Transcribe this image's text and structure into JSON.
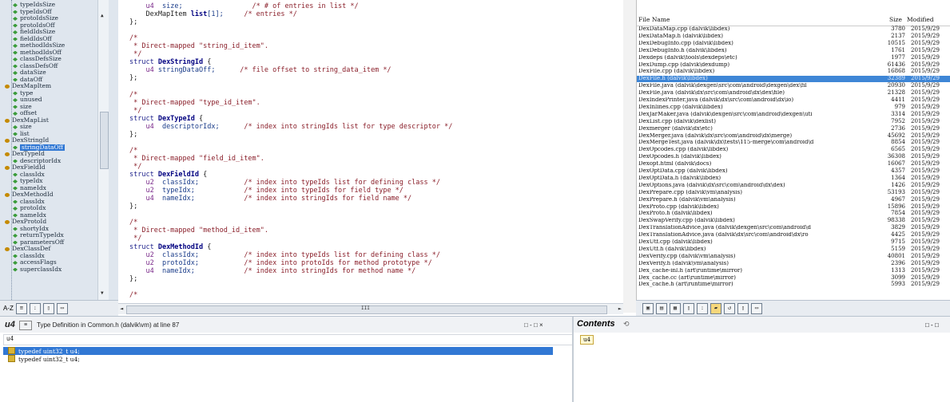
{
  "tree": {
    "rows": [
      {
        "label": "typeIdsSize",
        "kind": "field",
        "indent": 2
      },
      {
        "label": "typeIdsOff",
        "kind": "field",
        "indent": 2
      },
      {
        "label": "protoIdsSize",
        "kind": "field",
        "indent": 2
      },
      {
        "label": "protoIdsOff",
        "kind": "field",
        "indent": 2
      },
      {
        "label": "fieldIdsSize",
        "kind": "field",
        "indent": 2
      },
      {
        "label": "fieldIdsOff",
        "kind": "field",
        "indent": 2
      },
      {
        "label": "methodIdsSize",
        "kind": "field",
        "indent": 2
      },
      {
        "label": "methodIdsOff",
        "kind": "field",
        "indent": 2
      },
      {
        "label": "classDefsSize",
        "kind": "field",
        "indent": 2
      },
      {
        "label": "classDefsOff",
        "kind": "field",
        "indent": 2
      },
      {
        "label": "dataSize",
        "kind": "field",
        "indent": 2
      },
      {
        "label": "dataOff",
        "kind": "field",
        "indent": 2
      },
      {
        "label": "DexMapItem",
        "kind": "struct",
        "indent": 1
      },
      {
        "label": "type",
        "kind": "field",
        "indent": 2
      },
      {
        "label": "unused",
        "kind": "field",
        "indent": 2
      },
      {
        "label": "size",
        "kind": "field",
        "indent": 2
      },
      {
        "label": "offset",
        "kind": "field",
        "indent": 2
      },
      {
        "label": "DexMapList",
        "kind": "struct",
        "indent": 1
      },
      {
        "label": "size",
        "kind": "field",
        "indent": 2
      },
      {
        "label": "list",
        "kind": "field",
        "indent": 2
      },
      {
        "label": "DexStringId",
        "kind": "struct",
        "indent": 1
      },
      {
        "label": "stringDataOff",
        "kind": "field",
        "indent": 2,
        "selected": true
      },
      {
        "label": "DexTypeId",
        "kind": "struct",
        "indent": 1
      },
      {
        "label": "descriptorIdx",
        "kind": "field",
        "indent": 2
      },
      {
        "label": "DexFieldId",
        "kind": "struct",
        "indent": 1
      },
      {
        "label": "classIdx",
        "kind": "field",
        "indent": 2
      },
      {
        "label": "typeIdx",
        "kind": "field",
        "indent": 2
      },
      {
        "label": "nameIdx",
        "kind": "field",
        "indent": 2
      },
      {
        "label": "DexMethodId",
        "kind": "struct",
        "indent": 1
      },
      {
        "label": "classIdx",
        "kind": "field",
        "indent": 2
      },
      {
        "label": "protoIdx",
        "kind": "field",
        "indent": 2
      },
      {
        "label": "nameIdx",
        "kind": "field",
        "indent": 2
      },
      {
        "label": "DexProtoId",
        "kind": "struct",
        "indent": 1
      },
      {
        "label": "shortyIdx",
        "kind": "field",
        "indent": 2
      },
      {
        "label": "returnTypeIdx",
        "kind": "field",
        "indent": 2
      },
      {
        "label": "parametersOff",
        "kind": "field",
        "indent": 2
      },
      {
        "label": "DexClassDef",
        "kind": "struct",
        "indent": 1
      },
      {
        "label": "classIdx",
        "kind": "field",
        "indent": 2
      },
      {
        "label": "accessFlags",
        "kind": "field",
        "indent": 2
      },
      {
        "label": "superclassIdx",
        "kind": "field",
        "indent": 2
      }
    ],
    "toolbar_label": "A-Z"
  },
  "editor": {
    "lines": [
      [
        [
          "    ",
          ""
        ],
        [
          "u4",
          "tp"
        ],
        [
          "  size;",
          "fld"
        ],
        [
          "                 /* # of entries in list */",
          "cm"
        ]
      ],
      [
        [
          "    DexMapItem ",
          ""
        ],
        [
          "list",
          "idn"
        ],
        [
          "[1];",
          "fld"
        ],
        [
          "     /* entries */",
          "cm"
        ]
      ],
      [
        [
          "};",
          ""
        ]
      ],
      [
        [
          "",
          ""
        ]
      ],
      [
        [
          "/*",
          "cm"
        ]
      ],
      [
        [
          " * Direct-mapped \"string_id_item\".",
          "cm"
        ]
      ],
      [
        [
          " */",
          "cm"
        ]
      ],
      [
        [
          "struct ",
          "kw"
        ],
        [
          "DexStringId",
          "idn"
        ],
        [
          " {",
          ""
        ]
      ],
      [
        [
          "    ",
          ""
        ],
        [
          "u4",
          "tp"
        ],
        [
          " stringDataOff;",
          "fld"
        ],
        [
          "      /* file offset to string_data_item */",
          "cm"
        ]
      ],
      [
        [
          "};",
          ""
        ]
      ],
      [
        [
          "",
          ""
        ]
      ],
      [
        [
          "/*",
          "cm"
        ]
      ],
      [
        [
          " * Direct-mapped \"type_id_item\".",
          "cm"
        ]
      ],
      [
        [
          " */",
          "cm"
        ]
      ],
      [
        [
          "struct ",
          "kw"
        ],
        [
          "DexTypeId",
          "idn"
        ],
        [
          " {",
          ""
        ]
      ],
      [
        [
          "    ",
          ""
        ],
        [
          "u4",
          "tp"
        ],
        [
          "  descriptorIdx;",
          "fld"
        ],
        [
          "      /* index into stringIds list for type descriptor */",
          "cm"
        ]
      ],
      [
        [
          "};",
          ""
        ]
      ],
      [
        [
          "",
          ""
        ]
      ],
      [
        [
          "/*",
          "cm"
        ]
      ],
      [
        [
          " * Direct-mapped \"field_id_item\".",
          "cm"
        ]
      ],
      [
        [
          " */",
          "cm"
        ]
      ],
      [
        [
          "struct ",
          "kw"
        ],
        [
          "DexFieldId",
          "idn"
        ],
        [
          " {",
          ""
        ]
      ],
      [
        [
          "    ",
          ""
        ],
        [
          "u2",
          "tp"
        ],
        [
          "  classIdx;",
          "fld"
        ],
        [
          "           /* index into typeIds list for defining class */",
          "cm"
        ]
      ],
      [
        [
          "    ",
          ""
        ],
        [
          "u2",
          "tp"
        ],
        [
          "  typeIdx;",
          "fld"
        ],
        [
          "            /* index into typeIds for field type */",
          "cm"
        ]
      ],
      [
        [
          "    ",
          ""
        ],
        [
          "u4",
          "tp"
        ],
        [
          "  nameIdx;",
          "fld"
        ],
        [
          "            /* index into stringIds for field name */",
          "cm"
        ]
      ],
      [
        [
          "};",
          ""
        ]
      ],
      [
        [
          "",
          ""
        ]
      ],
      [
        [
          "/*",
          "cm"
        ]
      ],
      [
        [
          " * Direct-mapped \"method_id_item\".",
          "cm"
        ]
      ],
      [
        [
          " */",
          "cm"
        ]
      ],
      [
        [
          "struct ",
          "kw"
        ],
        [
          "DexMethodId",
          "idn"
        ],
        [
          " {",
          ""
        ]
      ],
      [
        [
          "    ",
          ""
        ],
        [
          "u2",
          "tp"
        ],
        [
          "  classIdx;",
          "fld"
        ],
        [
          "           /* index into typeIds list for defining class */",
          "cm"
        ]
      ],
      [
        [
          "    ",
          ""
        ],
        [
          "u2",
          "tp"
        ],
        [
          "  protoIdx;",
          "fld"
        ],
        [
          "           /* index into protoIds for method prototype */",
          "cm"
        ]
      ],
      [
        [
          "    ",
          ""
        ],
        [
          "u4",
          "tp"
        ],
        [
          "  nameIdx;",
          "fld"
        ],
        [
          "            /* index into stringIds for method name */",
          "cm"
        ]
      ],
      [
        [
          "};",
          ""
        ]
      ],
      [
        [
          "",
          ""
        ]
      ],
      [
        [
          "/*",
          "cm"
        ]
      ]
    ]
  },
  "files": {
    "headers": {
      "name": "File Name",
      "size": "Size",
      "modified": "Modified"
    },
    "rows": [
      {
        "name": "DexDataMap.cpp (dalvik\\libdex)",
        "size": "3780",
        "modified": "2015/9/29"
      },
      {
        "name": "DexDataMap.h (dalvik\\libdex)",
        "size": "2137",
        "modified": "2015/9/29"
      },
      {
        "name": "DexDebugInfo.cpp (dalvik\\libdex)",
        "size": "10515",
        "modified": "2015/9/29"
      },
      {
        "name": "DexDebugInfo.h (dalvik\\libdex)",
        "size": "1761",
        "modified": "2015/9/29"
      },
      {
        "name": "Dexdeps (dalvik\\tools\\dexdeps\\etc)",
        "size": "1977",
        "modified": "2015/9/29"
      },
      {
        "name": "DexDump.cpp (dalvik\\dexdump)",
        "size": "61436",
        "modified": "2015/9/29"
      },
      {
        "name": "DexFile.cpp (dalvik\\libdex)",
        "size": "16868",
        "modified": "2015/9/29"
      },
      {
        "name": "DexFile.h (dalvik\\libdex)",
        "size": "32389",
        "modified": "2015/9/29",
        "selected": true
      },
      {
        "name": "DexFile.java (dalvik\\dexgen\\src\\com\\android\\dexgen\\dex\\fil",
        "size": "20930",
        "modified": "2015/9/29"
      },
      {
        "name": "DexFile.java (dalvik\\dx\\src\\com\\android\\dx\\dex\\file)",
        "size": "21328",
        "modified": "2015/9/29"
      },
      {
        "name": "DexIndexPrinter.java (dalvik\\dx\\src\\com\\android\\dx\\io)",
        "size": "4411",
        "modified": "2015/9/29"
      },
      {
        "name": "DexInlines.cpp (dalvik\\libdex)",
        "size": "979",
        "modified": "2015/9/29"
      },
      {
        "name": "DexJarMaker.java (dalvik\\dexgen\\src\\com\\android\\dexgen\\uti",
        "size": "3314",
        "modified": "2015/9/29"
      },
      {
        "name": "DexList.cpp (dalvik\\dexlist)",
        "size": "7952",
        "modified": "2015/9/29"
      },
      {
        "name": "Dexmerger (dalvik\\dx\\etc)",
        "size": "2736",
        "modified": "2015/9/29"
      },
      {
        "name": "DexMerger.java (dalvik\\dx\\src\\com\\android\\dx\\merge)",
        "size": "45692",
        "modified": "2015/9/29"
      },
      {
        "name": "DexMergeTest.java (dalvik\\dx\\tests\\115-merge\\com\\android\\d",
        "size": "8854",
        "modified": "2015/9/29"
      },
      {
        "name": "DexOpcodes.cpp (dalvik\\libdex)",
        "size": "6565",
        "modified": "2015/9/29"
      },
      {
        "name": "DexOpcodes.h (dalvik\\libdex)",
        "size": "36308",
        "modified": "2015/9/29"
      },
      {
        "name": "Dexopt.html (dalvik\\docs)",
        "size": "16067",
        "modified": "2015/9/29"
      },
      {
        "name": "DexOptData.cpp (dalvik\\libdex)",
        "size": "4357",
        "modified": "2015/9/29"
      },
      {
        "name": "DexOptData.h (dalvik\\libdex)",
        "size": "1364",
        "modified": "2015/9/29"
      },
      {
        "name": "DexOptions.java (dalvik\\dx\\src\\com\\android\\dx\\dex)",
        "size": "1426",
        "modified": "2015/9/29"
      },
      {
        "name": "DexPrepare.cpp (dalvik\\vm\\analysis)",
        "size": "53193",
        "modified": "2015/9/29"
      },
      {
        "name": "DexPrepare.h (dalvik\\vm\\analysis)",
        "size": "4967",
        "modified": "2015/9/29"
      },
      {
        "name": "DexProto.cpp (dalvik\\libdex)",
        "size": "15896",
        "modified": "2015/9/29"
      },
      {
        "name": "DexProto.h (dalvik\\libdex)",
        "size": "7854",
        "modified": "2015/9/29"
      },
      {
        "name": "DexSwapVerify.cpp (dalvik\\libdex)",
        "size": "98338",
        "modified": "2015/9/29"
      },
      {
        "name": "DexTranslationAdvice.java (dalvik\\dexgen\\src\\com\\android\\d",
        "size": "3829",
        "modified": "2015/9/29"
      },
      {
        "name": "DexTranslationAdvice.java (dalvik\\dx\\src\\com\\android\\dx\\ro",
        "size": "4425",
        "modified": "2015/9/29"
      },
      {
        "name": "DexUtf.cpp (dalvik\\libdex)",
        "size": "9715",
        "modified": "2015/9/29"
      },
      {
        "name": "DexUtf.h (dalvik\\libdex)",
        "size": "5159",
        "modified": "2015/9/29"
      },
      {
        "name": "DexVerify.cpp (dalvik\\vm\\analysis)",
        "size": "40801",
        "modified": "2015/9/29"
      },
      {
        "name": "DexVerify.h (dalvik\\vm\\analysis)",
        "size": "2396",
        "modified": "2015/9/29"
      },
      {
        "name": "Dex_cache-inl.h (art\\runtime\\mirror)",
        "size": "1313",
        "modified": "2015/9/29"
      },
      {
        "name": "Dex_cache.cc (art\\runtime\\mirror)",
        "size": "3099",
        "modified": "2015/9/29"
      },
      {
        "name": "Dex_cache.h (art\\runtime\\mirror)",
        "size": "5993",
        "modified": "2015/9/29"
      }
    ]
  },
  "bottom_left": {
    "symbol": "u4",
    "title": "Type Definition in Common.h (dalvik\\vm) at line 87",
    "input_value": "u4",
    "rows": [
      {
        "text": "typedef uint32_t u4;",
        "selected": true
      },
      {
        "text": "typedef uint32_t u4;",
        "selected": false
      }
    ],
    "buttons": "□ - □ ×"
  },
  "bottom_right": {
    "title": "Contents",
    "chip": "u4",
    "buttons": "□ - □"
  },
  "scroll": {
    "left": "◄",
    "right": "►",
    "up": "▲",
    "down": "▼",
    "mid": "III"
  }
}
